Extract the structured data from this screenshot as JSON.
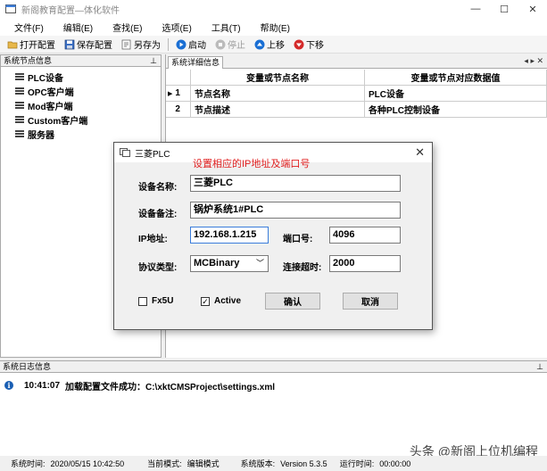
{
  "window": {
    "title": "新阁教育配置—体化软件",
    "controls": [
      "—",
      "☐",
      "✕"
    ]
  },
  "menu": [
    "文件(F)",
    "编辑(E)",
    "查找(E)",
    "选项(E)",
    "工具(T)",
    "帮助(E)"
  ],
  "toolbar": {
    "open_config": "打开配置",
    "save_config": "保存配置",
    "save_as": "另存为",
    "start": "启动",
    "stop": "停止",
    "move_up": "上移",
    "move_down": "下移"
  },
  "left_panel": {
    "title": "系统节点信息",
    "pin": "📌",
    "nodes": [
      "PLC设备",
      "OPC客户端",
      "Mod客户端",
      "Custom客户端",
      "服务器"
    ]
  },
  "right_panel": {
    "tab": "系统详细信息",
    "tab_controls": "◂ ▸ ✕",
    "columns": [
      "",
      "变量或节点名称",
      "变量或节点对应数据值"
    ],
    "rows": [
      {
        "index": "1",
        "name": "节点名称",
        "value": "PLC设备",
        "selected": true
      },
      {
        "index": "2",
        "name": "节点描述",
        "value": "各种PLC控制设备",
        "selected": false
      }
    ]
  },
  "log_panel": {
    "title": "系统日志信息",
    "entries": [
      {
        "time": "10:41:07",
        "message": "加载配置文件成功：C:\\xktCMSProject\\settings.xml"
      }
    ],
    "watermark": "头条 @新阁上位机编程"
  },
  "status_bar": {
    "system_time_label": "系统时间:",
    "system_time": "2020/05/15 10:42:50",
    "mode_label": "当前模式:",
    "mode": "编辑模式",
    "version_label": "系统版本:",
    "version": "Version  5.3.5",
    "runtime_label": "运行时间:",
    "runtime": "00:00:00"
  },
  "dialog": {
    "title": "三菱PLC",
    "hint": "设置相应的IP地址及端口号",
    "device_name_label": "设备名称:",
    "device_name": "三菱PLC",
    "device_note_label": "设备备注:",
    "device_note": "锅炉系统1#PLC",
    "ip_label": "IP地址:",
    "ip": "192.168.1.215",
    "port_label": "端口号:",
    "port": "4096",
    "protocol_label": "协议类型:",
    "protocol": "MCBinary",
    "timeout_label": "连接超时:",
    "timeout": "2000",
    "fx5u_label": "Fx5U",
    "fx5u_checked": false,
    "active_label": "Active",
    "active_checked": true,
    "confirm": "确认",
    "cancel": "取消"
  }
}
